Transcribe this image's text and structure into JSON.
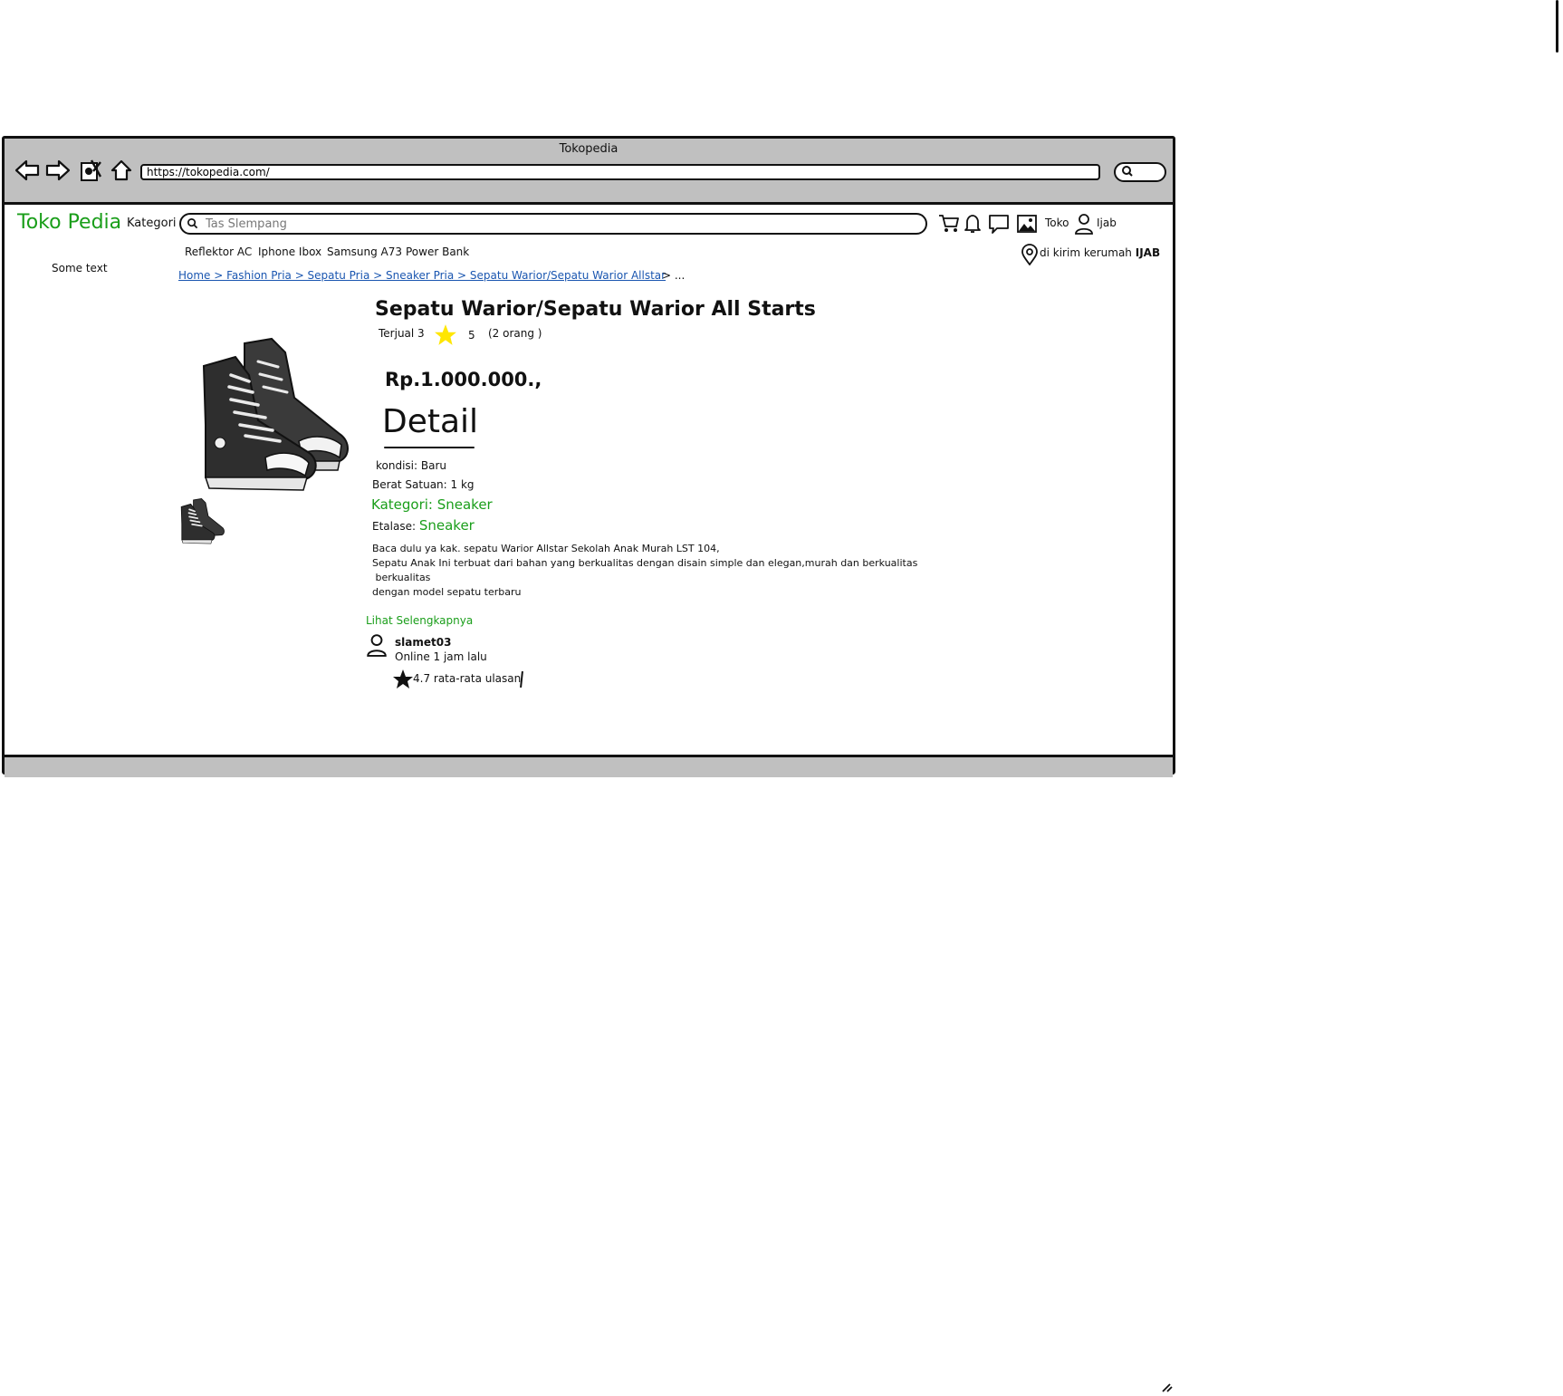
{
  "window": {
    "title": "Tokopedia",
    "url": "https://tokopedia.com/"
  },
  "header": {
    "logo": "Toko Pedia",
    "kategori_label": "Kategori",
    "search_placeholder": "Tas Slempang",
    "toko_label": "Toko",
    "user_label": "Ijab",
    "icons": [
      "cart-icon",
      "bell-icon",
      "chat-icon",
      "image-icon",
      "user-icon"
    ]
  },
  "quick_links": [
    "Reflektor AC",
    "Iphone Ibox",
    "Samsung A73",
    "Power Bank"
  ],
  "delivery": {
    "text": "di kirim kerumah",
    "name": "IJAB"
  },
  "sidebar_text": "Some text",
  "breadcrumb": {
    "path": "Home > Fashion Pria > Sepatu Pria > Sneaker Pria > Sepatu Warior/Sepatu Warior Allstar",
    "more": "> ..."
  },
  "product": {
    "title": "Sepatu Warior/Sepatu Warior All Starts",
    "sold": "Terjual 3",
    "rating": "5",
    "reviewers": "(2 orang )",
    "price": "Rp.1.000.000.,",
    "detail_heading": "Detail",
    "kondisi": "kondisi: Baru",
    "berat": "Berat Satuan: 1 kg",
    "kategori": "Kategori: Sneaker",
    "etalase_label": "Etalase:",
    "etalase_value": "Sneaker",
    "description": [
      "Baca dulu ya kak. sepatu Warior Allstar Sekolah Anak Murah LST 104,",
      "Sepatu Anak Ini terbuat dari bahan yang berkualitas dengan disain simple dan elegan,murah dan berkualitas",
      " berkualitas",
      "dengan model sepatu terbaru"
    ],
    "more_link": "Lihat Selengkapnya"
  },
  "seller": {
    "name": "slamet03",
    "status": "Online 1 jam lalu",
    "rating": "4.7 rata-rata ulasan"
  },
  "colors": {
    "brand_green": "#1a9e1a",
    "link_blue": "#1a56b0",
    "chrome_gray": "#c0c0c0",
    "star_yellow": "#ffe600"
  }
}
